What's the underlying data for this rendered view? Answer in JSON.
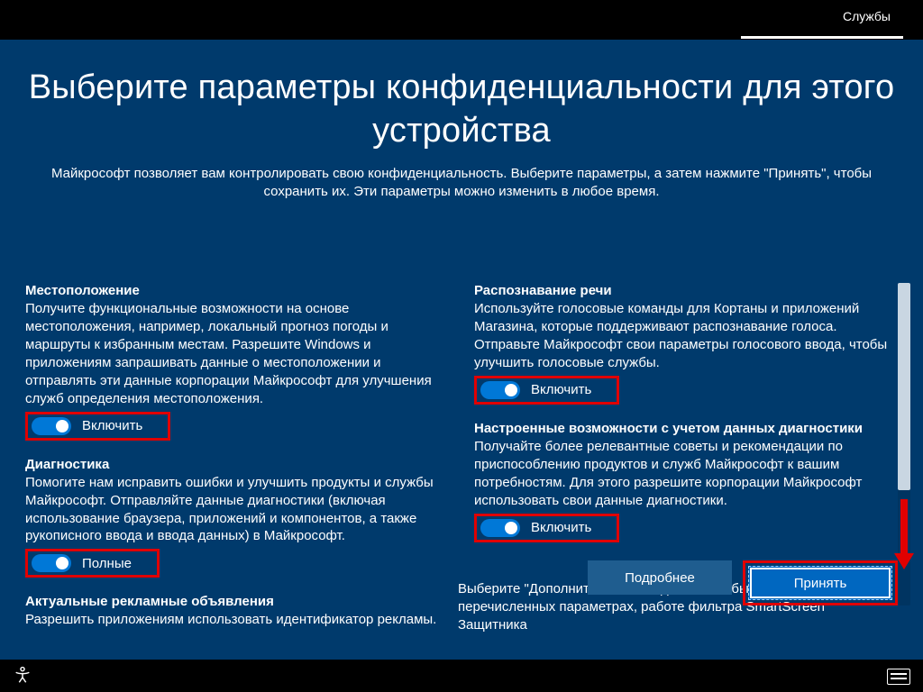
{
  "topbar": {
    "link": "Службы"
  },
  "page": {
    "title": "Выберите параметры конфиденциальности для этого устройства",
    "subtitle": "Майкрософт позволяет вам контролировать свою конфиденциальность. Выберите параметры, а затем нажмите \"Принять\", чтобы сохранить их. Эти параметры можно изменить в любое время."
  },
  "settings": {
    "location": {
      "title": "Местоположение",
      "desc": "Получите функциональные возможности на основе местоположения, например, локальный прогноз погоды и маршруты к избранным местам. Разрешите Windows и приложениям запрашивать данные о местоположении и отправлять эти данные корпорации Майкрософт для улучшения служб определения местоположения.",
      "toggle_label": "Включить"
    },
    "diagnostics": {
      "title": "Диагностика",
      "desc": "Помогите нам исправить ошибки и улучшить продукты и службы Майкрософт. Отправляйте данные диагностики (включая использование браузера, приложений и компонентов, а также рукописного ввода и ввода данных) в Майкрософт.",
      "toggle_label": "Полные"
    },
    "ads": {
      "title": "Актуальные рекламные объявления",
      "desc": "Разрешить приложениям использовать идентификатор рекламы."
    },
    "speech": {
      "title": "Распознавание речи",
      "desc": "Используйте голосовые команды для Кортаны и приложений Магазина, которые поддерживают распознавание голоса. Отправьте Майкрософт свои параметры голосового ввода, чтобы улучшить голосовые службы.",
      "toggle_label": "Включить"
    },
    "tailored": {
      "title": "Настроенные возможности с учетом данных диагностики",
      "desc": "Получайте более релевантные советы и рекомендации по приспособлению продуктов и служб Майкрософт к вашим потребностям. Для этого разрешите корпорации Майкрософт использовать свои данные диагностики.",
      "toggle_label": "Включить"
    },
    "more_info": "Выберите \"Дополнительные сведения\", чтобы узнать о перечисленных параметрах, работе фильтра SmartScreen Защитника"
  },
  "buttons": {
    "learn_more": "Подробнее",
    "accept": "Принять"
  },
  "colors": {
    "accent": "#0078d7",
    "highlight": "#e00000",
    "bg": "#003a6c"
  }
}
